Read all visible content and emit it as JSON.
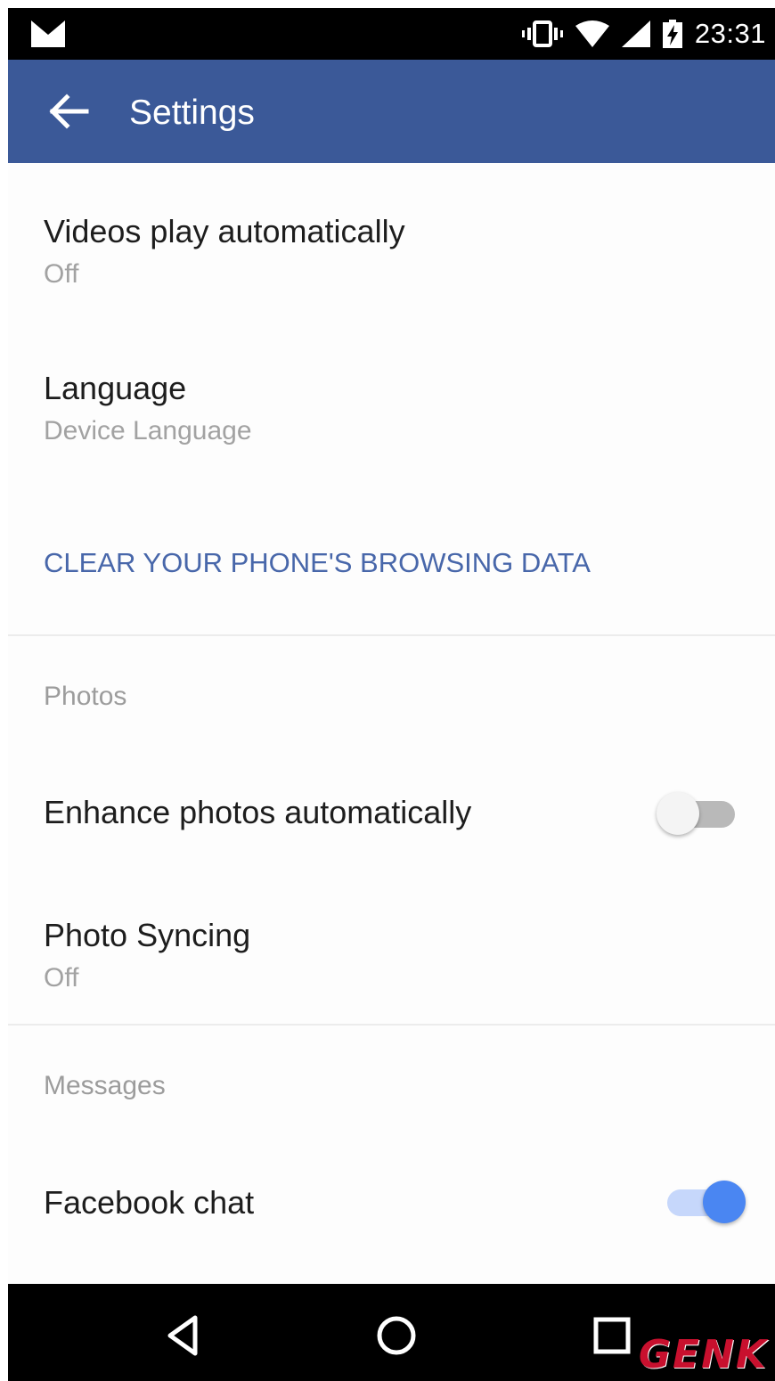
{
  "status_bar": {
    "time": "23:31",
    "icons": [
      "gmail-icon",
      "vibrate-icon",
      "wifi-icon",
      "signal-icon",
      "battery-charging-icon"
    ]
  },
  "app_bar": {
    "back_icon": "arrow-left-icon",
    "title": "Settings",
    "color": "#3b5998"
  },
  "settings": {
    "videos_autoplay": {
      "title": "Videos play automatically",
      "value": "Off"
    },
    "language": {
      "title": "Language",
      "value": "Device Language"
    },
    "clear_data_label": "CLEAR YOUR PHONE'S BROWSING DATA",
    "photos_section": {
      "header": "Photos",
      "enhance": {
        "title": "Enhance photos automatically",
        "enabled": false
      },
      "syncing": {
        "title": "Photo Syncing",
        "value": "Off"
      }
    },
    "messages_section": {
      "header": "Messages",
      "chat": {
        "title": "Facebook chat",
        "enabled": true
      }
    }
  },
  "colors": {
    "link": "#4867aa",
    "toggle_on": "#4a86f2"
  },
  "nav_bar": {
    "buttons": [
      "back-triangle-icon",
      "home-circle-icon",
      "recents-square-icon"
    ]
  },
  "watermark": "GENK"
}
